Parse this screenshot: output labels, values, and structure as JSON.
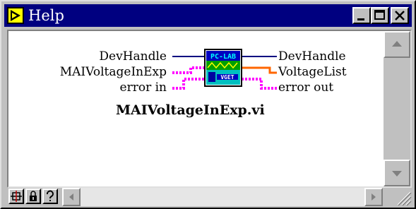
{
  "window": {
    "title": "Help",
    "icon": "labview-help-icon",
    "controls": {
      "minimize": "minimize-icon",
      "maximize": "maximize-icon",
      "close": "close-icon"
    }
  },
  "vi": {
    "name": "MAIVoltageInExp.vi",
    "icon_line1": "PC-LAB",
    "icon_line2": "VGET",
    "inputs": [
      {
        "label": "DevHandle",
        "wire_color": "#000080"
      },
      {
        "label": "MAIVoltageInExp",
        "wire_color": "#ff00ff"
      },
      {
        "label": "error in",
        "wire_color": "#ff00ff"
      }
    ],
    "outputs": [
      {
        "label": "DevHandle",
        "wire_color": "#000080"
      },
      {
        "label": "VoltageList",
        "wire_color": "#ff6600"
      },
      {
        "label": "error out",
        "wire_color": "#ff00ff"
      }
    ]
  },
  "toolbar": {
    "buttons": [
      "block-diagram-icon",
      "lock-icon",
      "help-question-icon"
    ]
  }
}
